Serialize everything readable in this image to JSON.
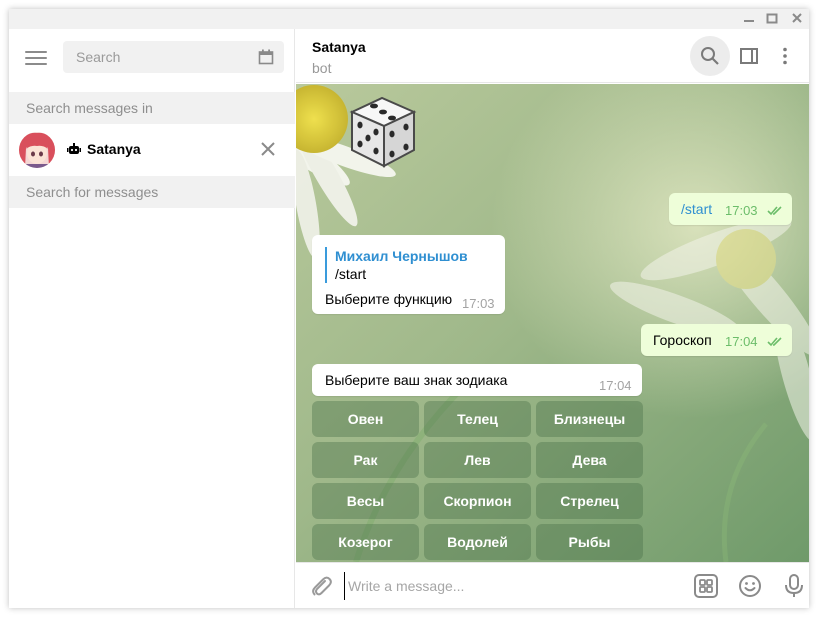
{
  "window": {
    "controls": [
      "minimize-icon",
      "maximize-icon",
      "close-icon"
    ]
  },
  "sidebar": {
    "menu_icon": "hamburger-icon",
    "search": {
      "placeholder": "Search",
      "value": "",
      "calendar_icon": "calendar-icon"
    },
    "search_in_label": "Search messages in",
    "chat": {
      "name": "Satanya",
      "bot_icon": "bot-icon",
      "close_icon": "close-icon"
    },
    "search_for_label": "Search for messages"
  },
  "header": {
    "title": "Satanya",
    "subtitle": "bot",
    "icons": [
      "search-icon",
      "sidebar-toggle-icon",
      "more-vertical-icon"
    ]
  },
  "messages": [
    {
      "type": "sticker",
      "icon": "dice-icon"
    },
    {
      "type": "out",
      "text": "/start",
      "time": "17:03",
      "status": "read"
    },
    {
      "type": "in",
      "reply_name": "Михаил Чернышов",
      "reply_text": "/start",
      "text": "Выберите функцию",
      "time": "17:03"
    },
    {
      "type": "out",
      "text": "Гороскоп",
      "time": "17:04",
      "status": "read"
    },
    {
      "type": "in",
      "text": "Выберите ваш знак зодиака",
      "time": "17:04"
    }
  ],
  "keyboard": [
    [
      "Овен",
      "Телец",
      "Близнецы"
    ],
    [
      "Рак",
      "Лев",
      "Дева"
    ],
    [
      "Весы",
      "Скорпион",
      "Стрелец"
    ],
    [
      "Козерог",
      "Водолей",
      "Рыбы"
    ]
  ],
  "composer": {
    "placeholder": "Write a message...",
    "value": "",
    "icons": [
      "attach-icon",
      "bot-keyboard-icon",
      "emoji-icon",
      "microphone-icon"
    ]
  },
  "colors": {
    "accent": "#2f8fd1",
    "outgoing_bubble": "#eefed9",
    "read_ticks": "#6cbd6a"
  }
}
